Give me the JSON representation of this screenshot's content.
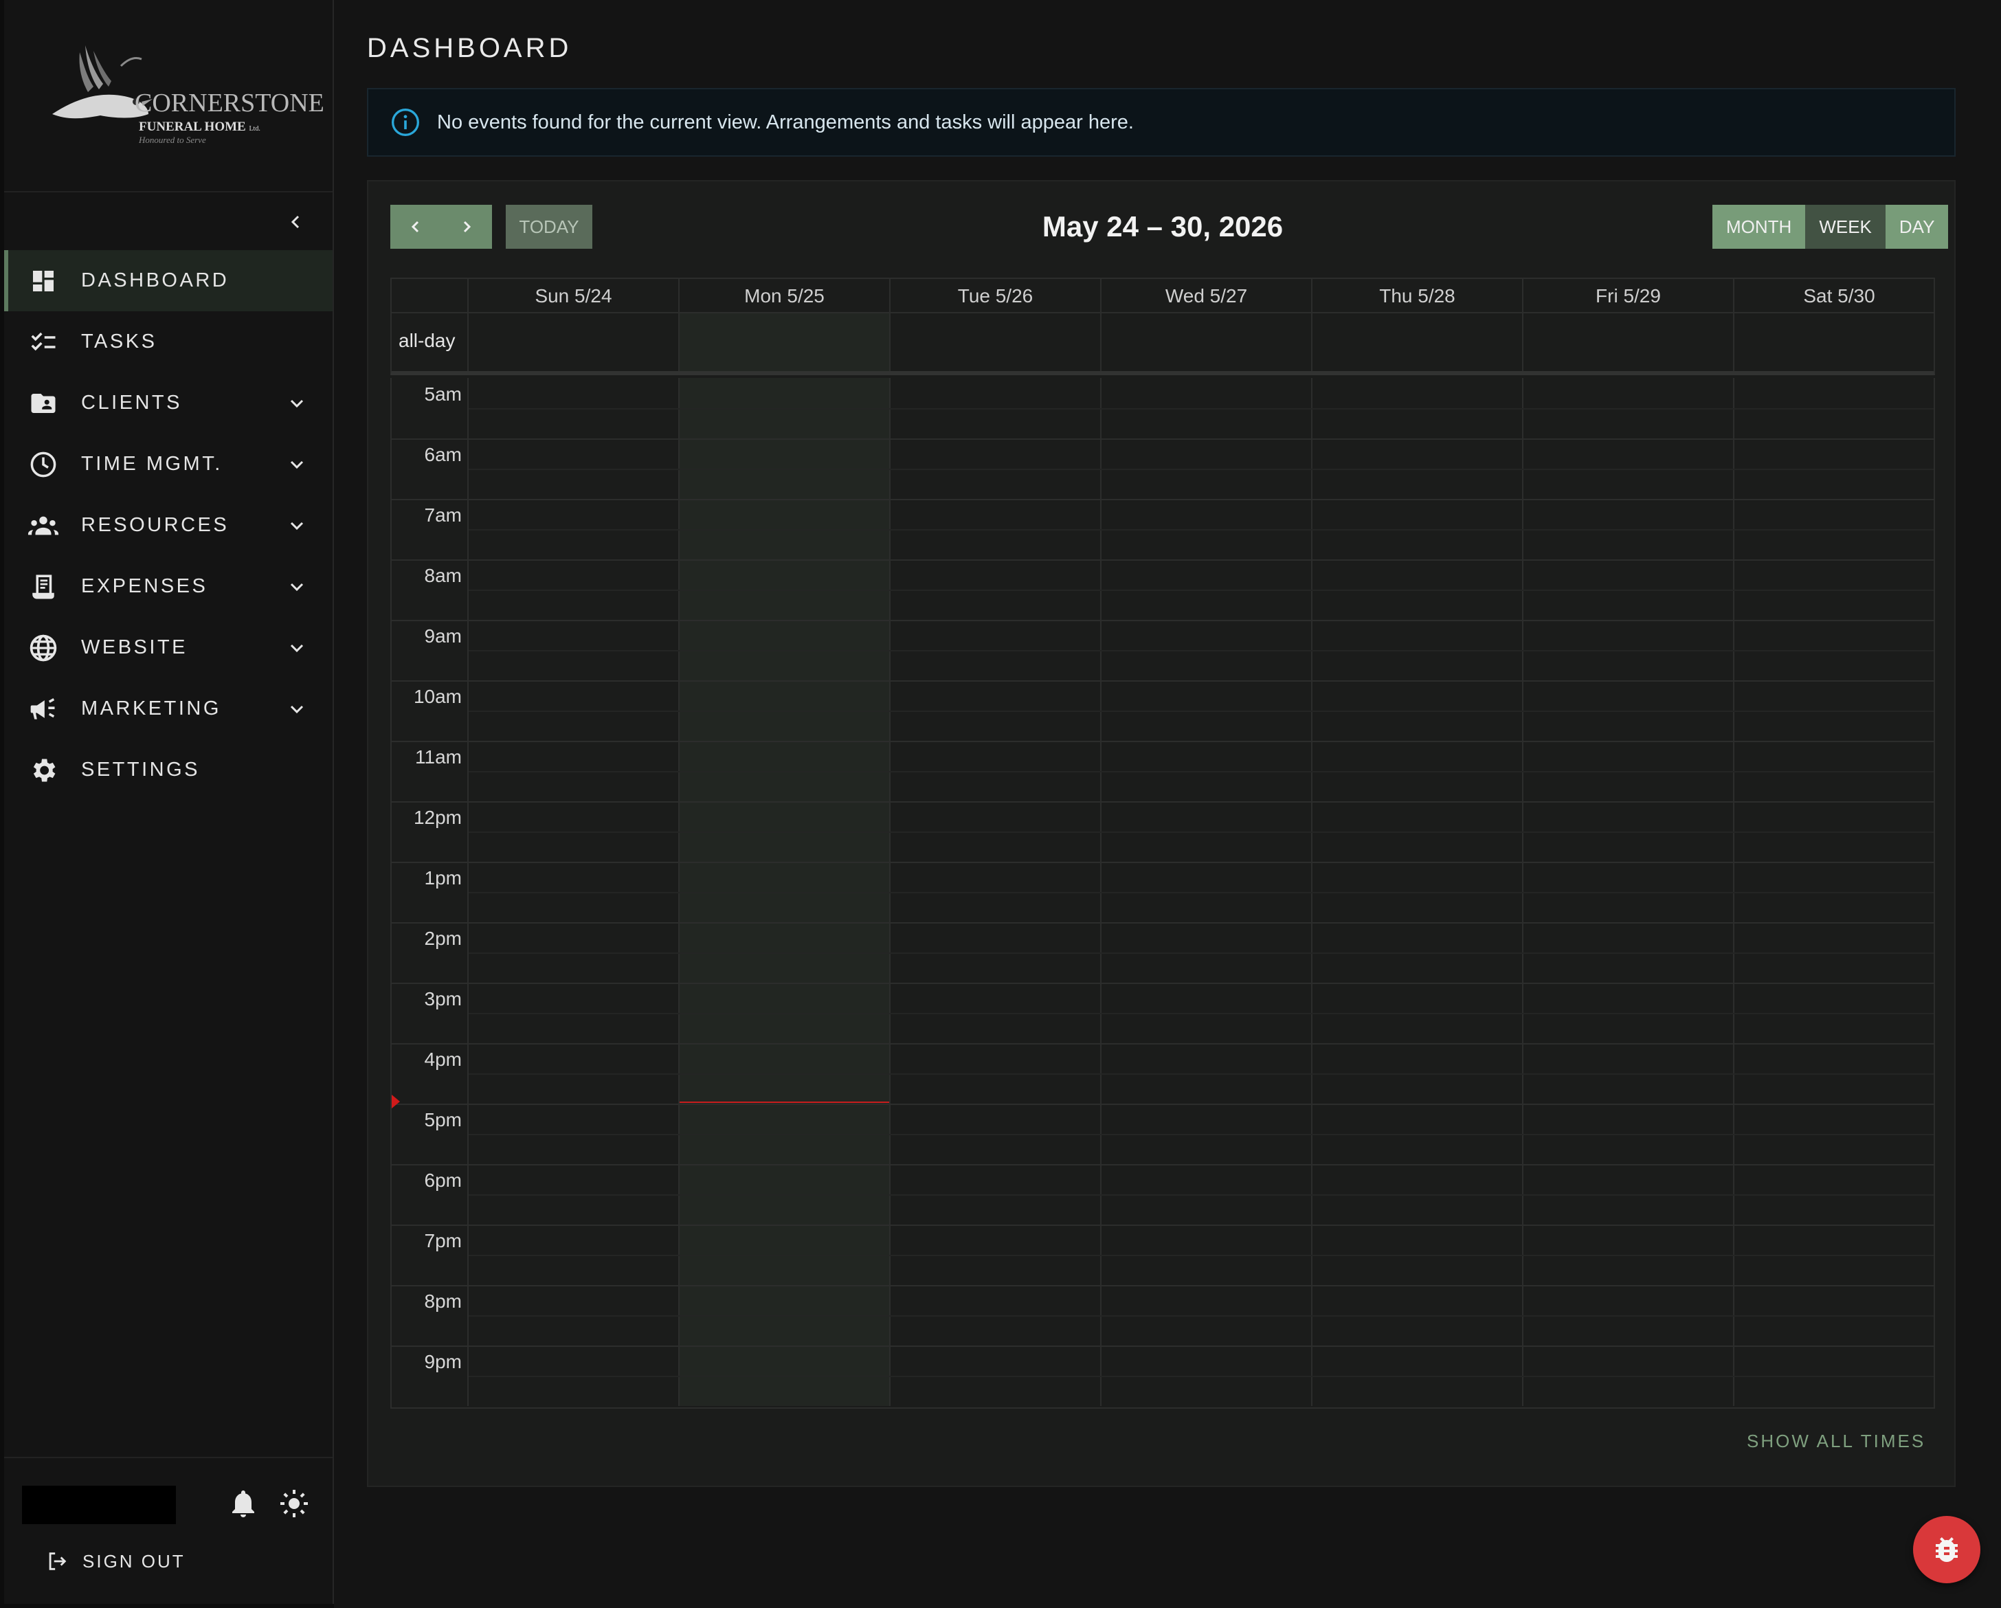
{
  "brand": {
    "name": "CORNERSTONE",
    "subtitle": "FUNERAL HOME",
    "subtitle_suffix": "Ltd.",
    "tagline": "Honoured to Serve"
  },
  "sidebar": {
    "items": [
      {
        "label": "DASHBOARD",
        "icon": "dashboard-icon",
        "active": true,
        "expandable": false
      },
      {
        "label": "TASKS",
        "icon": "checklist-icon",
        "active": false,
        "expandable": false
      },
      {
        "label": "CLIENTS",
        "icon": "contact-folder-icon",
        "active": false,
        "expandable": true
      },
      {
        "label": "TIME MGMT.",
        "icon": "clock-icon",
        "active": false,
        "expandable": true
      },
      {
        "label": "RESOURCES",
        "icon": "people-icon",
        "active": false,
        "expandable": true
      },
      {
        "label": "EXPENSES",
        "icon": "receipt-icon",
        "active": false,
        "expandable": true
      },
      {
        "label": "WEBSITE",
        "icon": "globe-icon",
        "active": false,
        "expandable": true
      },
      {
        "label": "MARKETING",
        "icon": "megaphone-icon",
        "active": false,
        "expandable": true
      },
      {
        "label": "SETTINGS",
        "icon": "gear-icon",
        "active": false,
        "expandable": false
      }
    ],
    "sign_out_label": "SIGN OUT"
  },
  "main": {
    "page_title": "DASHBOARD",
    "alert_text": "No events found for the current view. Arrangements and tasks will appear here."
  },
  "calendar": {
    "title": "May 24 – 30, 2026",
    "today_label": "TODAY",
    "views": [
      "MONTH",
      "WEEK",
      "DAY"
    ],
    "active_view": "WEEK",
    "days": [
      "Sun 5/24",
      "Mon 5/25",
      "Tue 5/26",
      "Wed 5/27",
      "Thu 5/28",
      "Fri 5/29",
      "Sat 5/30"
    ],
    "today_index": 1,
    "allday_label": "all-day",
    "hours": [
      "5am",
      "6am",
      "7am",
      "8am",
      "9am",
      "10am",
      "11am",
      "12pm",
      "1pm",
      "2pm",
      "3pm",
      "4pm",
      "5pm",
      "6pm",
      "7pm",
      "8pm",
      "9pm"
    ],
    "now_time": "16:58",
    "show_all_label": "SHOW ALL TIMES"
  },
  "colors": {
    "accent": "#6b8b6c",
    "now_indicator": "#c81d1d",
    "info": "#2aa7d9",
    "fab": "#d9383a"
  }
}
